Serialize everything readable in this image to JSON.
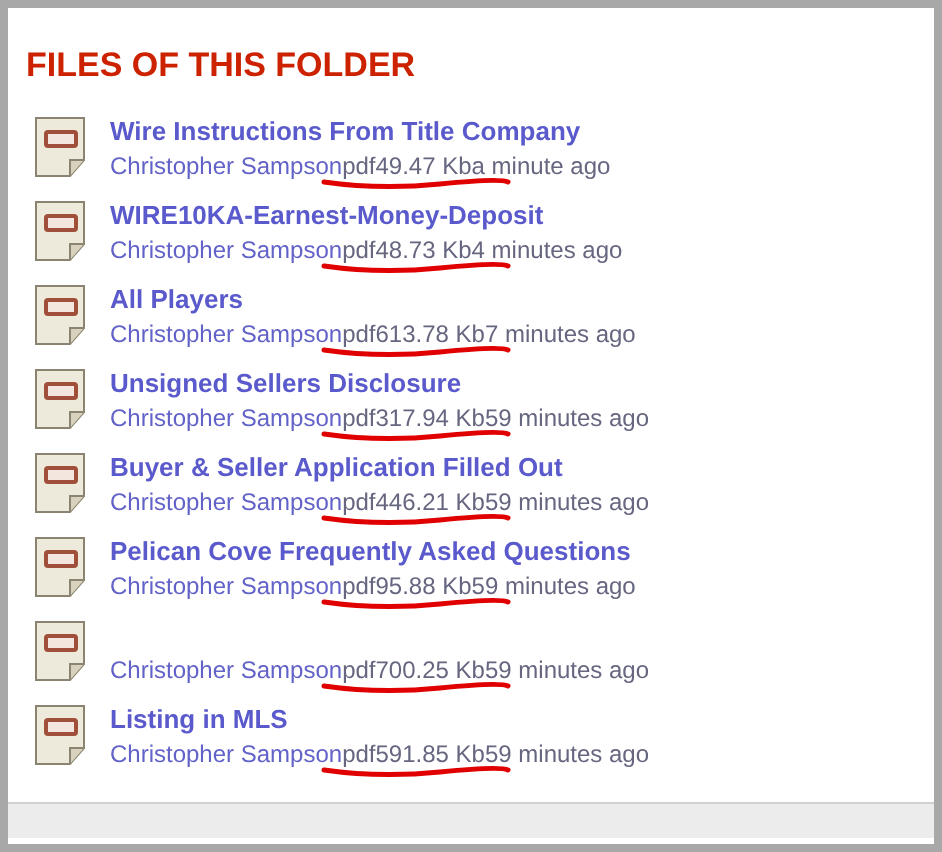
{
  "heading": "FILES OF THIS FOLDER",
  "files": [
    {
      "title": "Wire Instructions From Title Company",
      "author": "Christopher Sampson",
      "type": "pdf",
      "size": "49.47 Kb",
      "time": "a minute ago",
      "marked": true
    },
    {
      "title": "WIRE10KA-Earnest-Money-Deposit",
      "author": "Christopher Sampson",
      "type": "pdf",
      "size": "48.73 Kb",
      "time": "4 minutes ago",
      "marked": true
    },
    {
      "title": "All Players",
      "author": "Christopher Sampson",
      "type": "pdf",
      "size": "613.78 Kb",
      "time": "7 minutes ago",
      "marked": true
    },
    {
      "title": "Unsigned Sellers Disclosure",
      "author": "Christopher Sampson",
      "type": "pdf",
      "size": "317.94 Kb",
      "time": "59 minutes ago",
      "marked": true
    },
    {
      "title": "Buyer & Seller Application Filled Out",
      "author": "Christopher Sampson",
      "type": "pdf",
      "size": "446.21 Kb",
      "time": "59 minutes ago",
      "marked": true
    },
    {
      "title": "Pelican Cove Frequently Asked Questions",
      "author": "Christopher Sampson",
      "type": "pdf",
      "size": "95.88 Kb",
      "time": "59 minutes ago",
      "marked": true
    },
    {
      "author": "Christopher Sampson",
      "type": "pdf",
      "size": "700.25 Kb",
      "time": "59 minutes ago",
      "marked": true
    },
    {
      "title": "Listing in MLS",
      "author": "Christopher Sampson",
      "type": "pdf",
      "size": "591.85 Kb",
      "time": "59 minutes ago",
      "marked": true
    }
  ]
}
